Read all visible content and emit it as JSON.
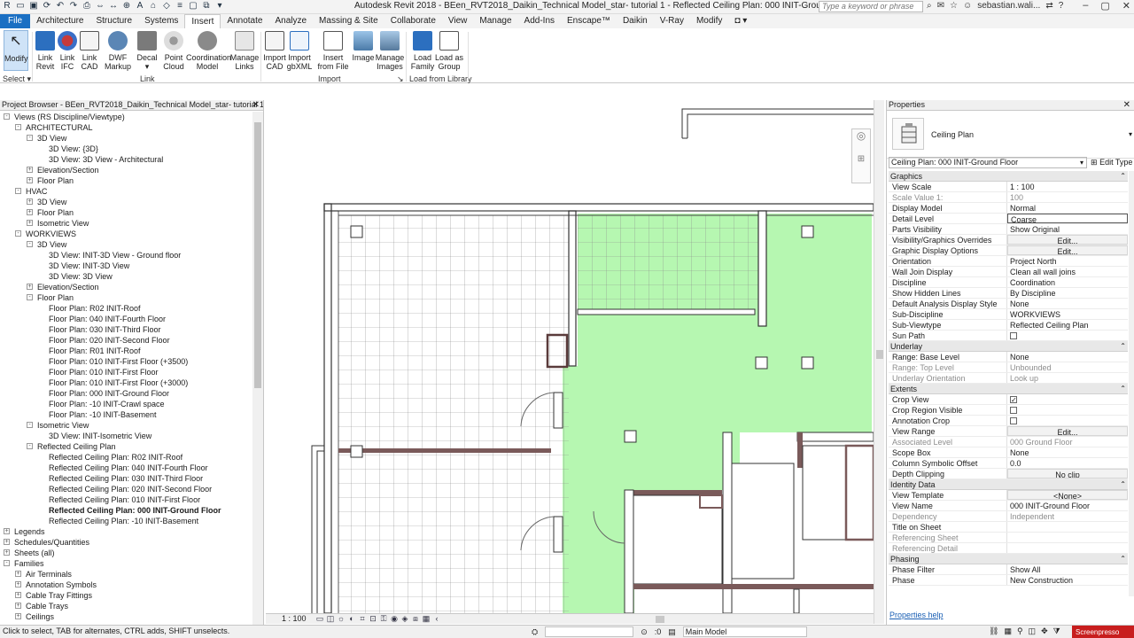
{
  "titlebar": {
    "title": "Autodesk Revit 2018 -   BEen_RVT2018_Daikin_Technical Model_star- tutorial 1 - Reflected Ceiling Plan: 000 INIT-Ground Floor",
    "search_placeholder": "Type a keyword or phrase",
    "user": "sebastian.wali..."
  },
  "tabs": [
    "File",
    "Architecture",
    "Structure",
    "Systems",
    "Insert",
    "Annotate",
    "Analyze",
    "Massing & Site",
    "Collaborate",
    "View",
    "Manage",
    "Add-Ins",
    "Enscape™",
    "Daikin",
    "V-Ray",
    "Modify"
  ],
  "ribbon": {
    "modify": [
      "Modify"
    ],
    "select_label": "Select",
    "buttons": [
      {
        "l1": "Link",
        "l2": "Revit"
      },
      {
        "l1": "Link",
        "l2": "IFC"
      },
      {
        "l1": "Link",
        "l2": "CAD"
      },
      {
        "l1": "DWF",
        "l2": "Markup"
      },
      {
        "l1": "Decal",
        "l2": ""
      },
      {
        "l1": "Point",
        "l2": "Cloud"
      },
      {
        "l1": "Coordination",
        "l2": "Model"
      },
      {
        "l1": "Manage",
        "l2": "Links"
      },
      {
        "l1": "Import",
        "l2": "CAD"
      },
      {
        "l1": "Import",
        "l2": "gbXML"
      },
      {
        "l1": "Insert",
        "l2": "from File"
      },
      {
        "l1": "Image",
        "l2": ""
      },
      {
        "l1": "Manage",
        "l2": "Images"
      },
      {
        "l1": "Load",
        "l2": "Family"
      },
      {
        "l1": "Load as",
        "l2": "Group"
      }
    ],
    "groups": {
      "link": "Link",
      "import": "Import",
      "library": "Load from Library"
    }
  },
  "browser": {
    "title": "Project Browser - BEen_RVT2018_Daikin_Technical Model_star- tutorial 1",
    "items": [
      "Views (RS Discipline/Viewtype)",
      "ARCHITECTURAL",
      "3D View",
      "3D View: {3D}",
      "3D View: 3D View - Architectural",
      "Elevation/Section",
      "Floor Plan",
      "HVAC",
      "3D View",
      "Floor Plan",
      "Isometric View",
      "WORKVIEWS",
      "3D View",
      "3D View: INIT-3D View - Ground floor",
      "3D View: INIT-3D View",
      "3D View: 3D View",
      "Elevation/Section",
      "Floor Plan",
      "Floor Plan: R02 INIT-Roof",
      "Floor Plan: 040 INIT-Fourth Floor",
      "Floor Plan: 030 INIT-Third Floor",
      "Floor Plan: 020 INIT-Second Floor",
      "Floor Plan: R01 INIT-Roof",
      "Floor Plan: 010 INIT-First Floor (+3500)",
      "Floor Plan: 010 INIT-First Floor",
      "Floor Plan: 010 INIT-First Floor (+3000)",
      "Floor Plan: 000 INIT-Ground Floor",
      "Floor Plan: -10 INIT-Crawl space",
      "Floor Plan: -10 INIT-Basement",
      "Isometric View",
      "3D View: INIT-Isometric View",
      "Reflected Ceiling Plan",
      "Reflected Ceiling Plan: R02 INIT-Roof",
      "Reflected Ceiling Plan: 040 INIT-Fourth Floor",
      "Reflected Ceiling Plan: 030 INIT-Third Floor",
      "Reflected Ceiling Plan: 020 INIT-Second Floor",
      "Reflected Ceiling Plan: 010 INIT-First Floor",
      "Reflected Ceiling Plan: 000 INIT-Ground Floor",
      "Reflected Ceiling Plan: -10 INIT-Basement",
      "Legends",
      "Schedules/Quantities",
      "Sheets (all)",
      "Families",
      "Air Terminals",
      "Annotation Symbols",
      "Cable Tray Fittings",
      "Cable Trays",
      "Ceilings"
    ]
  },
  "canvas": {
    "scale": "1 : 100",
    "accent_green": "#b6f7b1"
  },
  "properties": {
    "title": "Properties",
    "type_name": "Ceiling Plan",
    "instance": "Ceiling Plan: 000 INIT-Ground Floor",
    "edit_type": "Edit Type",
    "help": "Properties help",
    "sections": [
      {
        "name": "Graphics",
        "rows": [
          {
            "n": "View Scale",
            "v": "1 : 100"
          },
          {
            "n": "Scale Value    1:",
            "v": "100"
          },
          {
            "n": "Display Model",
            "v": "Normal"
          },
          {
            "n": "Detail Level",
            "v": "Coarse"
          },
          {
            "n": "Parts Visibility",
            "v": "Show Original"
          },
          {
            "n": "Visibility/Graphics Overrides",
            "v": "Edit..."
          },
          {
            "n": "Graphic Display Options",
            "v": "Edit..."
          },
          {
            "n": "Orientation",
            "v": "Project North"
          },
          {
            "n": "Wall Join Display",
            "v": "Clean all wall joins"
          },
          {
            "n": "Discipline",
            "v": "Coordination"
          },
          {
            "n": "Show Hidden Lines",
            "v": "By Discipline"
          },
          {
            "n": "Default Analysis Display Style",
            "v": "None"
          },
          {
            "n": "Sub-Discipline",
            "v": "WORKVIEWS"
          },
          {
            "n": "Sub-Viewtype",
            "v": "Reflected Ceiling Plan"
          },
          {
            "n": "Sun Path",
            "v": ""
          }
        ]
      },
      {
        "name": "Underlay",
        "rows": [
          {
            "n": "Range: Base Level",
            "v": "None"
          },
          {
            "n": "Range: Top Level",
            "v": "Unbounded"
          },
          {
            "n": "Underlay Orientation",
            "v": "Look up"
          }
        ]
      },
      {
        "name": "Extents",
        "rows": [
          {
            "n": "Crop View",
            "v": "✓"
          },
          {
            "n": "Crop Region Visible",
            "v": ""
          },
          {
            "n": "Annotation Crop",
            "v": ""
          },
          {
            "n": "View Range",
            "v": "Edit..."
          },
          {
            "n": "Associated Level",
            "v": "000 Ground Floor"
          },
          {
            "n": "Scope Box",
            "v": "None"
          },
          {
            "n": "Column Symbolic Offset",
            "v": "0.0"
          },
          {
            "n": "Depth Clipping",
            "v": "No clip"
          }
        ]
      },
      {
        "name": "Identity Data",
        "rows": [
          {
            "n": "View Template",
            "v": "<None>"
          },
          {
            "n": "View Name",
            "v": "000 INIT-Ground Floor"
          },
          {
            "n": "Dependency",
            "v": "Independent"
          },
          {
            "n": "Title on Sheet",
            "v": ""
          },
          {
            "n": "Referencing Sheet",
            "v": ""
          },
          {
            "n": "Referencing Detail",
            "v": ""
          }
        ]
      },
      {
        "name": "Phasing",
        "rows": [
          {
            "n": "Phase Filter",
            "v": "Show All"
          },
          {
            "n": "Phase",
            "v": "New Construction"
          }
        ]
      }
    ]
  },
  "status": {
    "hint": "Click to select, TAB for alternates, CTRL adds, SHIFT unselects.",
    "zero": ":0",
    "model": "Main Model",
    "watermark": "Screenpresso"
  }
}
